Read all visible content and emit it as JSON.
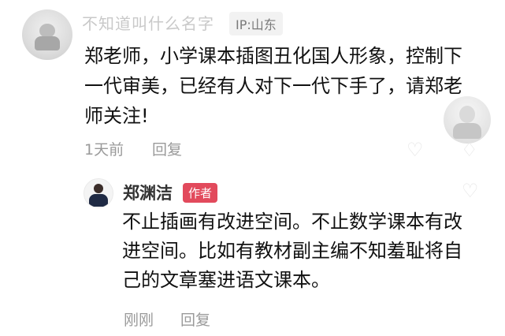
{
  "comment": {
    "username": "不知道叫什么名字",
    "ip": "IP:山东",
    "text": "郑老师，小学课本插图丑化国人形象，控制下一代审美，已经有人对下一代下手了，请郑老师关注!",
    "time": "1天前",
    "reply_label": "回复"
  },
  "reply": {
    "username": "郑渊洁",
    "badge": "作者",
    "text": "不止插画有改进空间。不止数学课本有改进空间。比如有教材副主编不知羞耻将自己的文章塞进语文课本。",
    "time": "刚刚",
    "reply_label": "回复"
  },
  "icons": {
    "side": [
      "like-icon",
      "dislike-icon",
      "heart-icon"
    ],
    "colors": {
      "author_badge": "#e24a5c",
      "muted_text": "#9a9a9a"
    }
  }
}
